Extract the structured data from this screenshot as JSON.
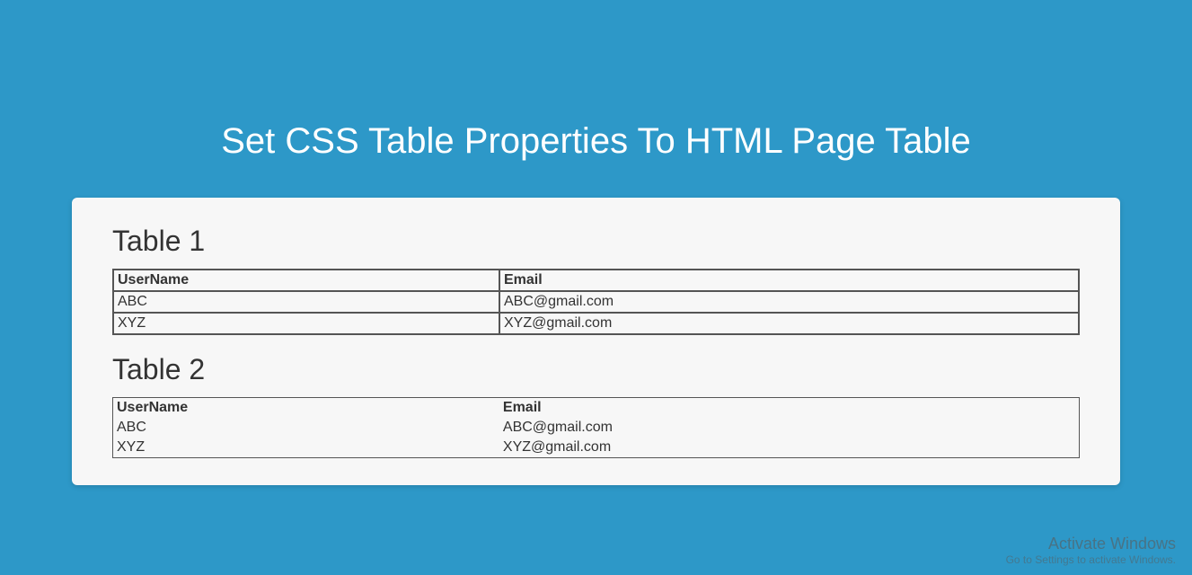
{
  "page_title": "Set CSS Table Properties To HTML Page Table",
  "tables": [
    {
      "title": "Table 1",
      "headers": [
        "UserName",
        "Email"
      ],
      "rows": [
        [
          "ABC",
          "ABC@gmail.com"
        ],
        [
          "XYZ",
          "XYZ@gmail.com"
        ]
      ]
    },
    {
      "title": "Table 2",
      "headers": [
        "UserName",
        "Email"
      ],
      "rows": [
        [
          "ABC",
          "ABC@gmail.com"
        ],
        [
          "XYZ",
          "XYZ@gmail.com"
        ]
      ]
    }
  ],
  "watermark": {
    "title": "Activate Windows",
    "subtitle": "Go to Settings to activate Windows."
  }
}
